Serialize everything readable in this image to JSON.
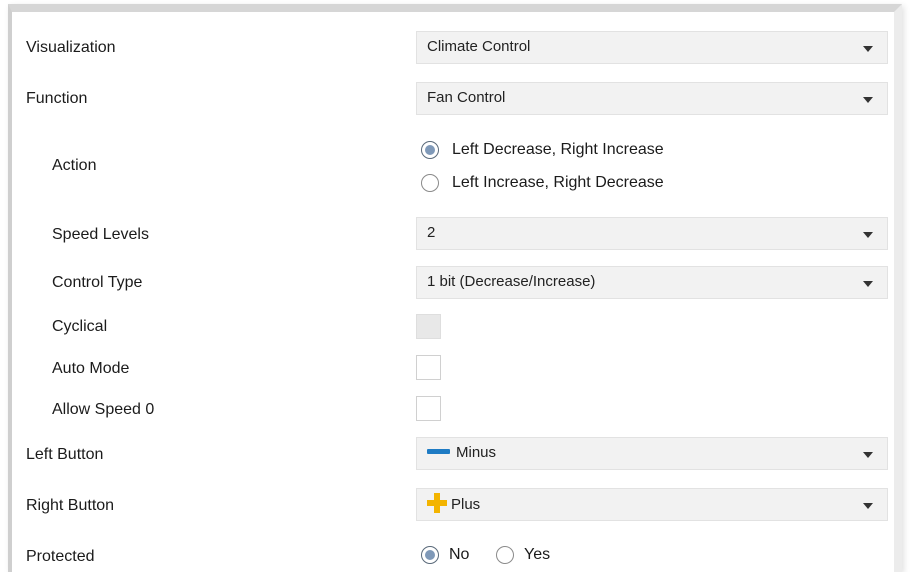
{
  "rows": {
    "visualization": {
      "label": "Visualization",
      "value": "Climate Control"
    },
    "function": {
      "label": "Function",
      "value": "Fan Control"
    },
    "action": {
      "label": "Action",
      "options": [
        "Left Decrease, Right Increase",
        "Left Increase, Right Decrease"
      ],
      "selected_index": 0
    },
    "speed_levels": {
      "label": "Speed Levels",
      "value": "2"
    },
    "control_type": {
      "label": "Control Type",
      "value": "1 bit (Decrease/Increase)"
    },
    "cyclical": {
      "label": "Cyclical",
      "checked": false,
      "disabled": true
    },
    "auto_mode": {
      "label": "Auto Mode",
      "checked": false
    },
    "allow_speed_0": {
      "label": "Allow Speed 0",
      "checked": false
    },
    "left_button": {
      "label": "Left Button",
      "value": "Minus",
      "icon": "minus-icon",
      "icon_color": "#1e7bc4"
    },
    "right_button": {
      "label": "Right Button",
      "value": "Plus",
      "icon": "plus-icon",
      "icon_color": "#f3b400"
    },
    "protected": {
      "label": "Protected",
      "options": [
        "No",
        "Yes"
      ],
      "selected_index": 0
    }
  },
  "colors": {
    "dropdown_bg": "#f2f2f2",
    "radio_selected": "#7f99b8"
  }
}
